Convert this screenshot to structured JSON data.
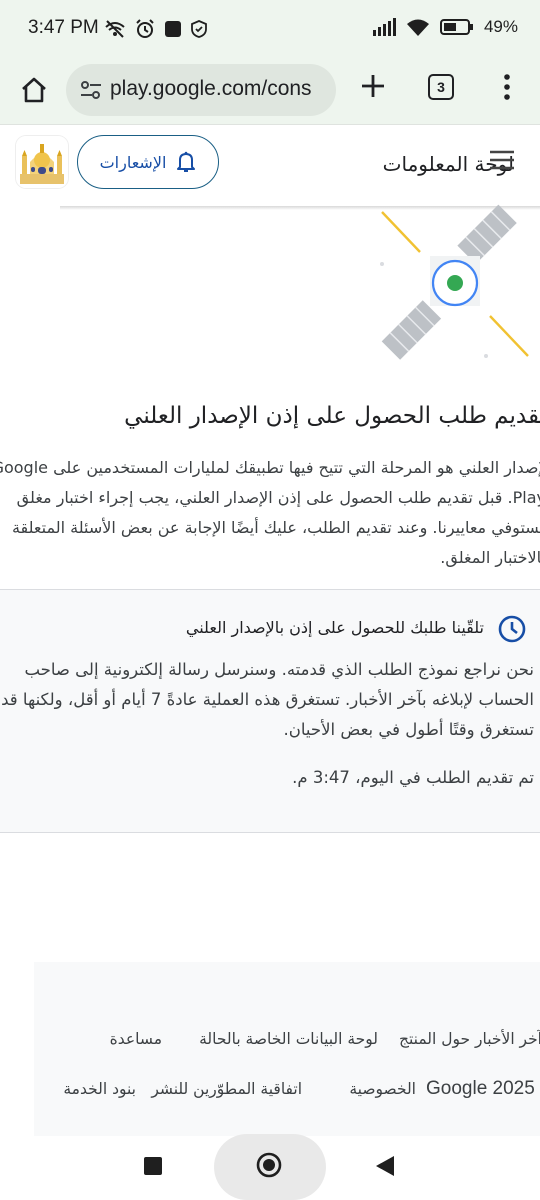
{
  "status_bar": {
    "time": "3:47 PM",
    "battery": "49%",
    "icons_left": [
      "wifi-off-icon",
      "alarm-icon",
      "stop-icon",
      "shield-icon"
    ],
    "icons_right": [
      "signal-icon",
      "wifi-icon",
      "battery-icon"
    ]
  },
  "browser": {
    "url": "play.google.com/cons",
    "tab_count": "3"
  },
  "header": {
    "title": "لوحة المعلومات",
    "notifications_label": "الإشعارات"
  },
  "main": {
    "title": "تقديم طلب الحصول على إذن الإصدار العلني",
    "description_lines": [
      "الإصدار العلني هو المرحلة التي تتيح فيها تطبيقك لمليارات المستخدمين على Google",
      "Play. قبل تقديم طلب الحصول على إذن الإصدار العلني، يجب إجراء اختبار مغلق",
      "يستوفي معاييرنا. وعند تقديم الطلب، عليك أيضًا الإجابة عن بعض الأسئلة المتعلقة",
      "بالاختبار المغلق."
    ]
  },
  "status_card": {
    "heading": "تلقّينا طلبك للحصول على إذن بالإصدار العلني",
    "body_lines": [
      "نحن نراجع نموذج الطلب الذي قدمته. وسنرسل رسالة إلكترونية إلى صاحب",
      "الحساب لإبلاغه بآخر الأخبار. تستغرق هذه العملية عادةً 7 أيام أو أقل، ولكنها قد",
      "تستغرق وقتًا أطول في بعض الأحيان."
    ],
    "submitted": "تم تقديم الطلب في اليوم، 3:47 م."
  },
  "footer": {
    "links_row1": [
      "آخر الأخبار حول المنتج",
      "لوحة البيانات الخاصة بالحالة",
      "مساعدة"
    ],
    "copyright": "Google 2025",
    "links_row2": [
      "الخصوصية",
      "اتفاقية المطوّرين للنشر",
      "بنود الخدمة"
    ]
  },
  "colors": {
    "accent": "#174ea6",
    "chrome_bg": "#eef5ee",
    "status_green": "#34a853",
    "satellite_gray": "#bdc1c6",
    "ray_yellow": "#f1c232"
  }
}
